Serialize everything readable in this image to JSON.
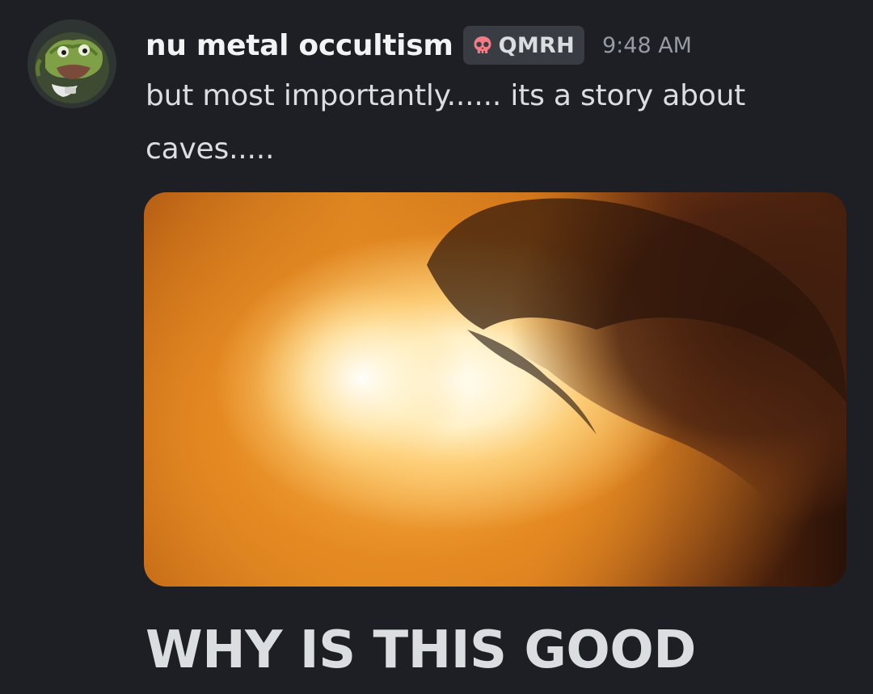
{
  "message": {
    "author": {
      "username": "nu metal occultism",
      "tag": {
        "label": "QMRH",
        "icon": "skull-icon",
        "icon_color": "#f27b85"
      },
      "avatar_icon": "frog-avatar"
    },
    "timestamp": "9:48 AM",
    "text": "but most importantly...... its a story about caves.....",
    "attachment": {
      "type": "image",
      "description_colors": [
        "#fff6e0",
        "#e58a22",
        "#2a1208"
      ]
    },
    "caption": "WHY IS THIS GOOD"
  },
  "colors": {
    "background": "#1e1f24",
    "username": "#f2f3f5",
    "text": "#dbdee1",
    "timestamp": "#949ba4",
    "tag_background": "#3a3c44"
  }
}
